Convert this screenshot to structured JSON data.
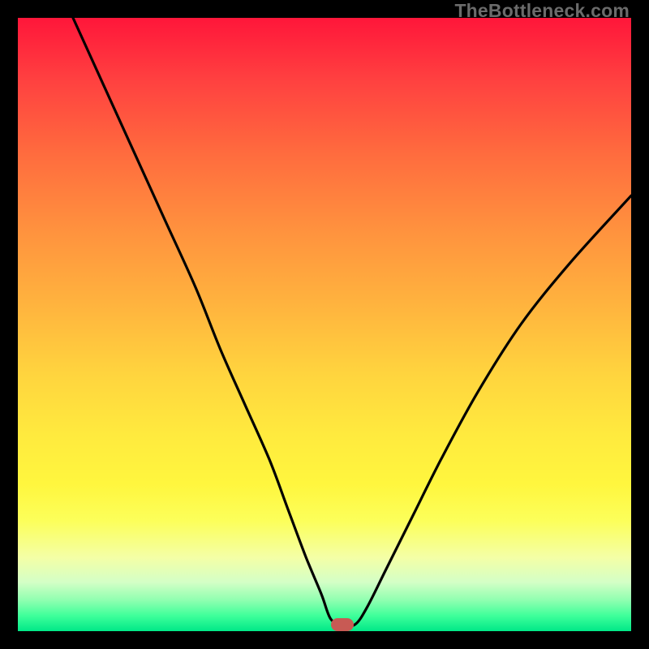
{
  "watermark": "TheBottleneck.com",
  "marker": {
    "cx_frac": 0.529,
    "cy_frac": 0.989
  },
  "chart_data": {
    "type": "line",
    "title": "",
    "xlabel": "",
    "ylabel": "",
    "xlim": [
      0,
      100
    ],
    "ylim": [
      0,
      100
    ],
    "series": [
      {
        "name": "bottleneck-curve",
        "x": [
          9.0,
          14,
          19,
          24,
          29,
          33,
          37,
          41,
          44,
          47,
          49.5,
          51,
          52.9,
          55,
          57,
          60,
          64,
          69,
          75,
          82,
          90,
          100
        ],
        "values": [
          100,
          89,
          78,
          67,
          56,
          46,
          37,
          28,
          20,
          12,
          6,
          2,
          1.1,
          1.1,
          4,
          10,
          18,
          28,
          39,
          50,
          60,
          71
        ]
      }
    ],
    "note": "x is fraction of plot width (0=left,100=right); values are fraction of plot height from bottom (0=bottom,100=top). Curve represents bottleneck percentage vs. component balance; minimum (~1%) near x≈53%.",
    "marker": {
      "x": 52.9,
      "y": 1.1,
      "color": "#c85a54"
    }
  }
}
